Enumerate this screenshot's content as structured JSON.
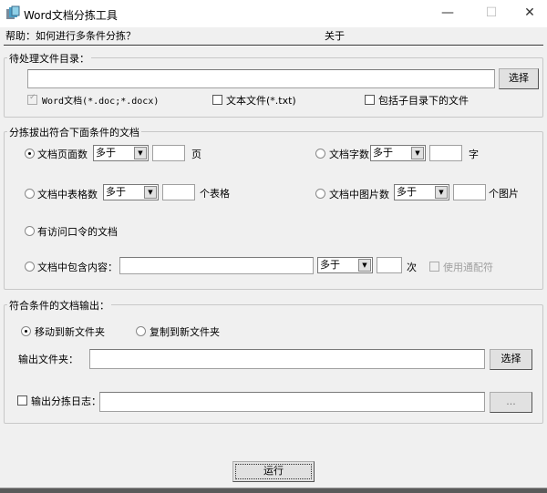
{
  "window": {
    "title": "Word文档分拣工具",
    "minimize": "—",
    "maximize": "☐",
    "close": "✕"
  },
  "menu": {
    "help": "帮助：如何进行多条件分拣？",
    "about": "关于"
  },
  "source": {
    "legend": "待处理文件目录：",
    "path_value": "",
    "choose": "选择",
    "word_docs": "Word文档(*.doc;*.docx)",
    "text_files": "文本文件(*.txt)",
    "include_subdirs": "包括子目录下的文件"
  },
  "criteria": {
    "legend": "分拣拔出符合下面条件的文档",
    "page_count": {
      "label": "文档页面数",
      "op": "多于",
      "value": "",
      "unit": "页"
    },
    "word_count": {
      "label": "文档字数",
      "op": "多于",
      "value": "",
      "unit": "字"
    },
    "table_count": {
      "label": "文档中表格数",
      "op": "多于",
      "value": "",
      "unit": "个表格"
    },
    "image_count": {
      "label": "文档中图片数",
      "op": "多于",
      "value": "",
      "unit": "个图片"
    },
    "password": {
      "label": "有访问口令的文档"
    },
    "contains": {
      "label": "文档中包含内容：",
      "text": "",
      "op": "多于",
      "value": "",
      "unit": "次",
      "wildcard": "使用通配符"
    }
  },
  "output": {
    "legend": "符合条件的文档输出：",
    "move": "移动到新文件夹",
    "copy": "复制到新文件夹",
    "folder_label": "输出文件夹：",
    "folder_value": "",
    "choose": "选择",
    "log_label": "输出分拣日志：",
    "log_value": "",
    "browse": "..."
  },
  "run": "运行"
}
